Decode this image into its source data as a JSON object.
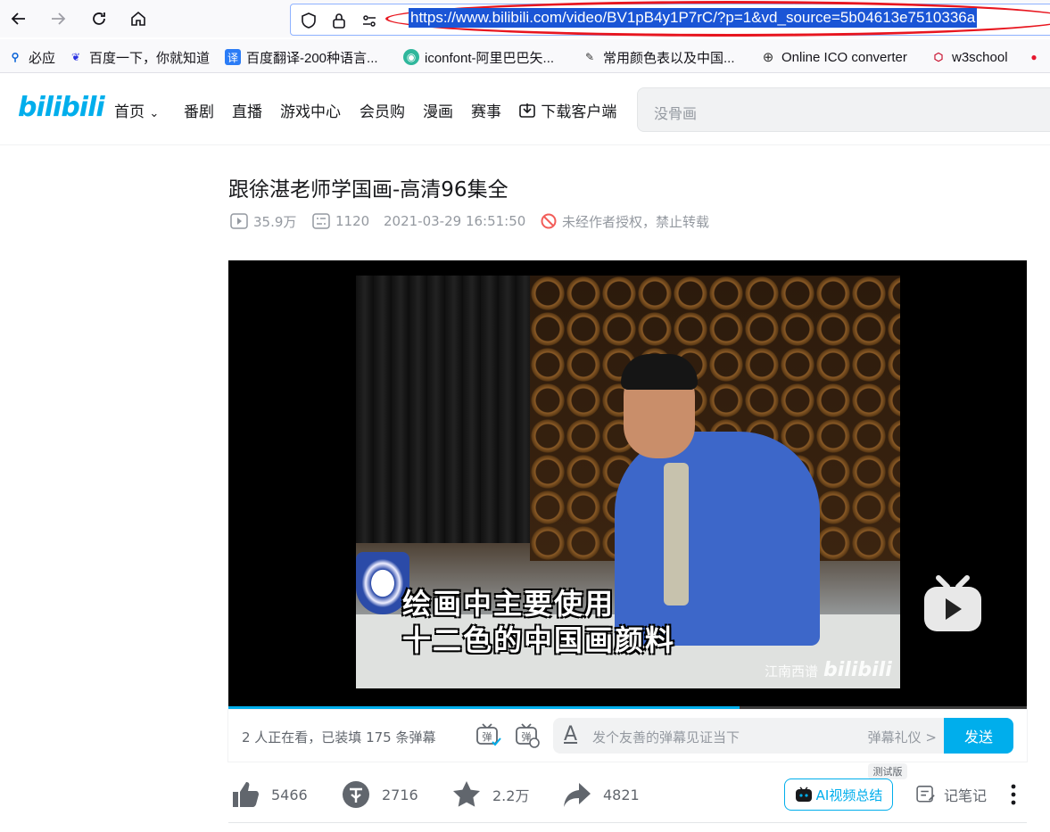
{
  "browser": {
    "url": "https://www.bilibili.com/video/BV1pB4y1P7rC/?p=1&vd_source=5b04613e7510336a",
    "back_icon": "arrow-left-icon",
    "forward_icon": "arrow-right-icon",
    "reload_icon": "reload-icon",
    "home_icon": "home-icon",
    "highlight_color": "#e8161f"
  },
  "bookmarks": [
    {
      "label": "必应",
      "icon": "search-icon"
    },
    {
      "label": "百度一下，你就知道",
      "icon": "baidu-paw-icon"
    },
    {
      "label": "百度翻译-200种语言...",
      "icon": "translate-icon"
    },
    {
      "label": "iconfont-阿里巴巴矢...",
      "icon": "iconfont-icon"
    },
    {
      "label": "常用颜色表以及中国...",
      "icon": "site-icon"
    },
    {
      "label": "Online ICO converter",
      "icon": "globe-icon"
    },
    {
      "label": "w3school",
      "icon": "w3school-icon"
    }
  ],
  "header": {
    "logo": "bilibili",
    "nav": [
      {
        "label": "首页"
      },
      {
        "label": "番剧"
      },
      {
        "label": "直播"
      },
      {
        "label": "游戏中心"
      },
      {
        "label": "会员购"
      },
      {
        "label": "漫画"
      },
      {
        "label": "赛事"
      },
      {
        "label": "下载客户端"
      }
    ],
    "search_placeholder": "没骨画",
    "accent_color": "#00aeec"
  },
  "video": {
    "title": "跟徐湛老师学国画-高清96集全",
    "views": "35.9万",
    "danmaku_count": "1120",
    "date": "2021-03-29 16:51:50",
    "copyright": "未经作者授权，禁止转载",
    "subtitle_line1": "绘画中主要使用",
    "subtitle_line2": "十二色的中国画颜料",
    "watermark_text": "江南西谱",
    "watermark_logo": "bilibili",
    "progress": 0.64
  },
  "danmaku": {
    "watching": "2 人正在看，已装填 175 条弹幕",
    "toggle_label": "弹",
    "placeholder": "发个友善的弹幕见证当下",
    "etiquette": "弹幕礼仪 >",
    "send": "发送"
  },
  "actions": {
    "like": "5466",
    "coin": "2716",
    "favorite": "2.2万",
    "share": "4821",
    "ai_summary": "AI视频总结",
    "beta": "测试版",
    "notes": "记笔记"
  }
}
